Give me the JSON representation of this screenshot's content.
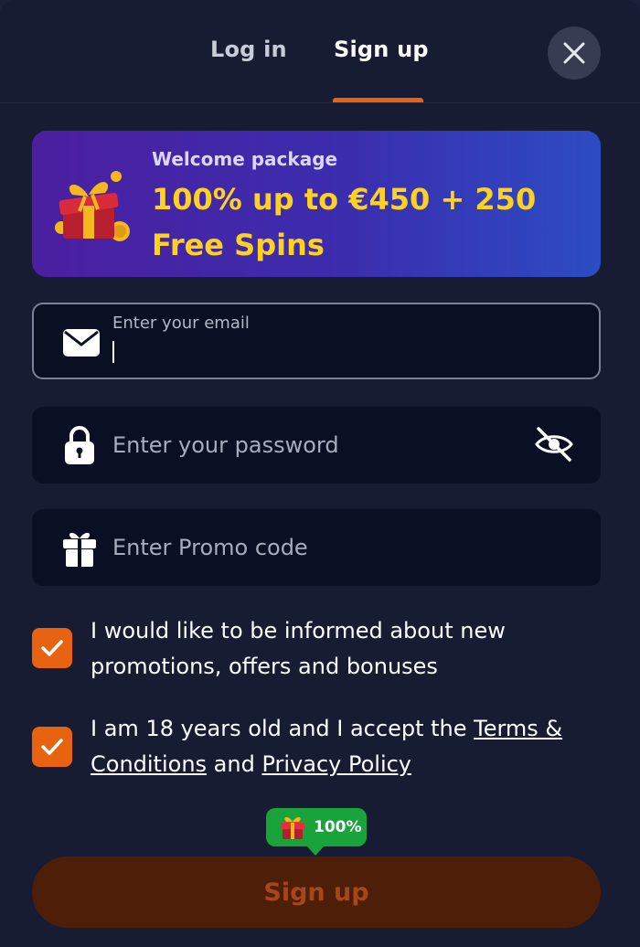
{
  "tabs": {
    "login": "Log in",
    "signup": "Sign up",
    "active": "signup"
  },
  "close": {
    "icon": "close-icon"
  },
  "banner": {
    "subtitle": "Welcome package",
    "title": "100% up to €450 + 250 Free Spins",
    "icon": "gift-box-icon"
  },
  "form": {
    "email": {
      "label": "Enter your email",
      "value": "",
      "icon": "envelope-icon"
    },
    "password": {
      "placeholder": "Enter your password",
      "icon": "lock-icon",
      "toggle_icon": "eye-off-icon"
    },
    "promo": {
      "placeholder": "Enter Promo code",
      "icon": "gift-icon"
    }
  },
  "consents": {
    "marketing": {
      "text": "I would like to be informed about new promotions, offers and bonuses",
      "checked": true
    },
    "terms": {
      "prefix": "I am 18 years old and I accept the ",
      "terms_link": "Terms & Conditions",
      "middle": " and ",
      "privacy_link": "Privacy Policy",
      "checked": true
    }
  },
  "bonus_badge": {
    "text": "100%",
    "icon": "gift-icon"
  },
  "submit": {
    "label": "Sign up"
  },
  "colors": {
    "accent": "#e8630f",
    "banner_text": "#ffd21f",
    "badge": "#1aa33a",
    "background": "#171c33"
  }
}
